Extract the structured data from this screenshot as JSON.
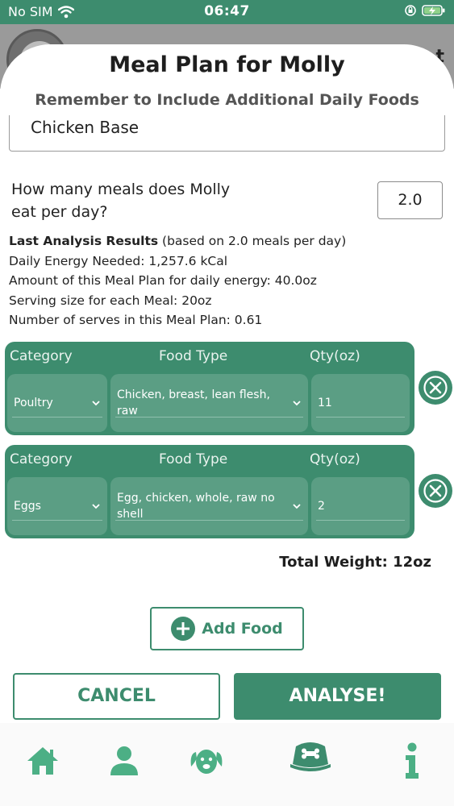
{
  "status_bar": {
    "carrier": "No SIM",
    "time": "06:47"
  },
  "sheet": {
    "title": "Meal Plan for Molly",
    "subtitle": "Remember to Include Additional Daily Foods",
    "plan_name": "Chicken Base"
  },
  "meals": {
    "question": "How many meals does Molly eat per day?",
    "value": "2.0"
  },
  "analysis": {
    "heading": "Last Analysis Results",
    "heading_note": " (based on 2.0 meals per day)",
    "lines": [
      "Daily Energy Needed: 1,257.6 kCal",
      "Amount of this Meal Plan for daily energy: 40.0oz",
      "Serving size for each Meal: 20oz",
      "Number of serves in this Meal Plan: 0.61"
    ]
  },
  "food_headers": {
    "category": "Category",
    "food_type": "Food Type",
    "qty": "Qty(oz)"
  },
  "foods": [
    {
      "category": "Poultry",
      "food_type": "Chicken, breast, lean flesh, raw",
      "qty": "11"
    },
    {
      "category": "Eggs",
      "food_type": "Egg, chicken, whole, raw no shell",
      "qty": "2"
    }
  ],
  "total_weight": "Total Weight: 12oz",
  "buttons": {
    "add_food": "Add Food",
    "cancel": "CANCEL",
    "analyse": "ANALYSE!"
  },
  "tabs": [
    "home-icon",
    "profile-icon",
    "dog-icon",
    "food-bowl-icon",
    "info-icon"
  ],
  "colors": {
    "primary": "#3d8c6e",
    "cell": "#5b9e84",
    "tab_icon": "#4caf85"
  }
}
